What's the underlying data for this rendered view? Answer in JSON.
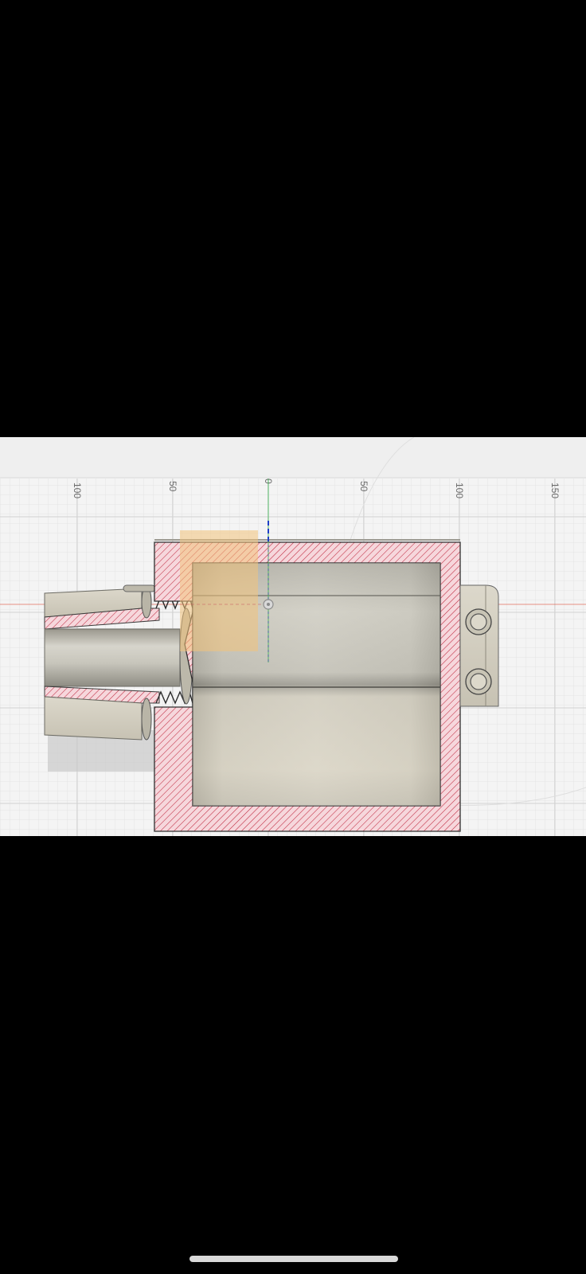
{
  "ruler": {
    "labels": [
      "100",
      "50",
      "0",
      "50",
      "100",
      "150"
    ]
  },
  "colors": {
    "section_fill": "#f6d7dc",
    "hatch": "#c0283f",
    "body_tan": "#cfcabb",
    "origin_x_axis": "#e0503a",
    "origin_y_axis": "#37b24d",
    "z_axis": "#1e3fc7",
    "selection_box": "#f3c27a"
  },
  "icons": [
    "origin-point-icon"
  ]
}
